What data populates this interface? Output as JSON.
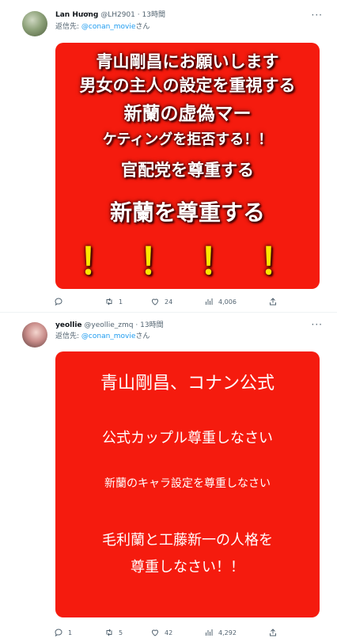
{
  "tweets": [
    {
      "author_name": "Lan Hương",
      "handle": "@LH2901",
      "dot": "·",
      "time": "13時間",
      "reply_prefix": "返信先: ",
      "reply_mention": "@conan_movie",
      "reply_suffix": "さん",
      "image_lines": [
        "青山剛昌にお願いします",
        "男女の主人の設定を重視する",
        "新蘭の虚偽マー",
        "ケティングを拒否する！！",
        "官配党を尊重する",
        "新蘭を尊重する",
        "！！！！"
      ],
      "replies": "",
      "retweets": "1",
      "likes": "24",
      "views": "4,006"
    },
    {
      "author_name": "yeollie",
      "handle": "@yeollie_zmq",
      "dot": "·",
      "time": "13時間",
      "reply_prefix": "返信先: ",
      "reply_mention": "@conan_movie",
      "reply_suffix": "さん",
      "image_lines": [
        "青山剛昌、コナン公式",
        "公式カップル尊重しなさい",
        "新蘭のキャラ設定を尊重しなさい",
        "毛利蘭と工藤新一の人格を",
        "尊重しなさい！！"
      ],
      "replies": "1",
      "retweets": "5",
      "likes": "42",
      "views": "4,292"
    }
  ],
  "icons": {
    "more": "more-icon",
    "reply": "reply-icon",
    "retweet": "retweet-icon",
    "like": "heart-icon",
    "views": "views-icon",
    "share": "share-icon"
  },
  "colors": {
    "card_red": "#f51b0e",
    "mention_blue": "#1d9bf0",
    "secondary_text": "#536471",
    "exclamation_yellow": "#ffe600"
  }
}
